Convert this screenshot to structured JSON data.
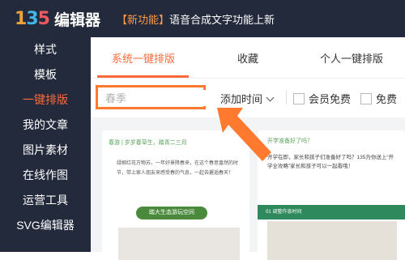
{
  "header": {
    "logo_mark": [
      "1",
      "3",
      "5"
    ],
    "logo_text": "编辑器",
    "notice_tag": "【新功能】",
    "notice_text": "语音合成文字功能上新"
  },
  "sidebar": {
    "items": [
      {
        "label": "样式",
        "active": false
      },
      {
        "label": "模板",
        "active": false
      },
      {
        "label": "一键排版",
        "active": true
      },
      {
        "label": "我的文章",
        "active": false
      },
      {
        "label": "图片素材",
        "active": false
      },
      {
        "label": "在线作图",
        "active": false
      },
      {
        "label": "运营工具",
        "active": false
      },
      {
        "label": "SVG编辑器",
        "active": false
      }
    ]
  },
  "tabs": {
    "system": "系统一键排版",
    "favorites": "收藏",
    "personal": "个人一键排版"
  },
  "filters": {
    "search_placeholder": "春季",
    "sort_label": "添加时间",
    "member_free": "会员免费",
    "free": "免费"
  },
  "cards": [
    {
      "head": "春游 | 岁岁春草生，踏青二三月",
      "body": "绿柳红花万物苏，一年好景降春来，在这个春意盎然的时节，带上家人朋友来感受春的气息，一起去邂逅春天！",
      "pill": "踏大生态游玩空间"
    },
    {
      "head": "开学准备好了吗？",
      "body": "开学在即，家长和孩子们准备好了吗？135为你送上“开学全攻略”家长和孩子可以一起看哦！",
      "bar": "01 调整作息时间"
    }
  ],
  "colors": {
    "accent": "#ff6a3d",
    "sidebar_bg": "#232a3c",
    "highlight_border": "#ff7a2e",
    "arrow": "#ff7a2e"
  }
}
